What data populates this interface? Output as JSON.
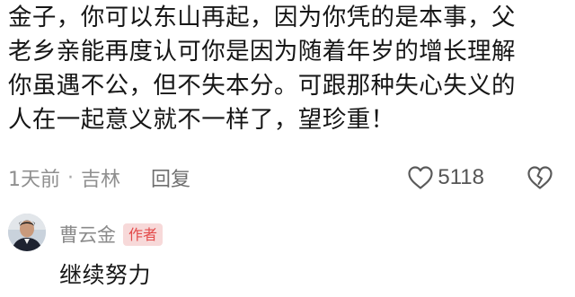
{
  "comment": {
    "text_lines": [
      "金子，你可以东山再起，因为你凭的是本事，父",
      "老乡亲能再度认可你是因为随着年岁的增长理解",
      "你虽遇不公，但不失本分。可跟那种失心失义的",
      "人在一起意义就不一样了，望珍重！"
    ],
    "time": "1天前",
    "separator": "·",
    "location": "吉林",
    "reply_label": "回复",
    "like_icon": "heart-outline-icon",
    "like_count": "5118",
    "dislike_icon": "broken-heart-icon"
  },
  "reply": {
    "avatar": "user-avatar",
    "author": "曹云金",
    "badge": "作者",
    "text": "继续努力"
  },
  "colors": {
    "text": "#161616",
    "meta": "#8f8f8f",
    "badge_bg": "#f7d9d9",
    "badge_text": "#e34a4a"
  }
}
